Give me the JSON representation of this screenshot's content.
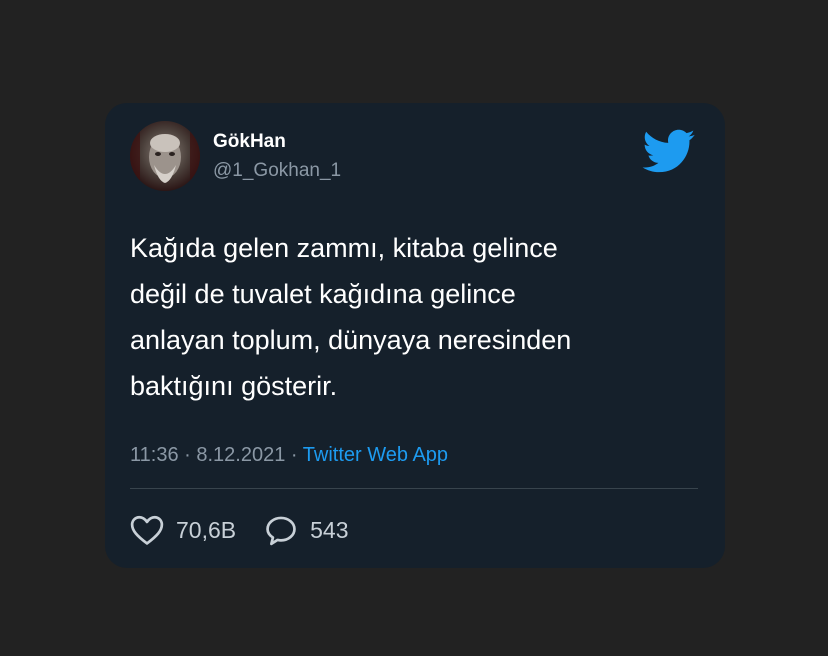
{
  "author": {
    "display_name": "GökHan",
    "handle": "@1_Gokhan_1",
    "avatar_icon": "profile-photo"
  },
  "brand": {
    "logo_icon": "twitter-bird-icon",
    "color": "#1d9bf0"
  },
  "tweet": {
    "lines": [
      "Kağıda gelen zammı, kitaba gelince",
      "değil de tuvalet kağıdına gelince",
      "anlayan toplum, dünyaya neresinden",
      "baktığını gösterir."
    ],
    "time": "11:36",
    "separator": "·",
    "date": "8.12.2021",
    "source": "Twitter Web App"
  },
  "stats": {
    "likes": "70,6B",
    "likes_icon": "heart-icon",
    "replies": "543",
    "replies_icon": "reply-bubble-icon"
  },
  "colors": {
    "page_background": "#222222",
    "card_background": "#15202b",
    "text_primary": "#ffffff",
    "text_secondary": "#8b98a5",
    "divider": "#38444d"
  }
}
